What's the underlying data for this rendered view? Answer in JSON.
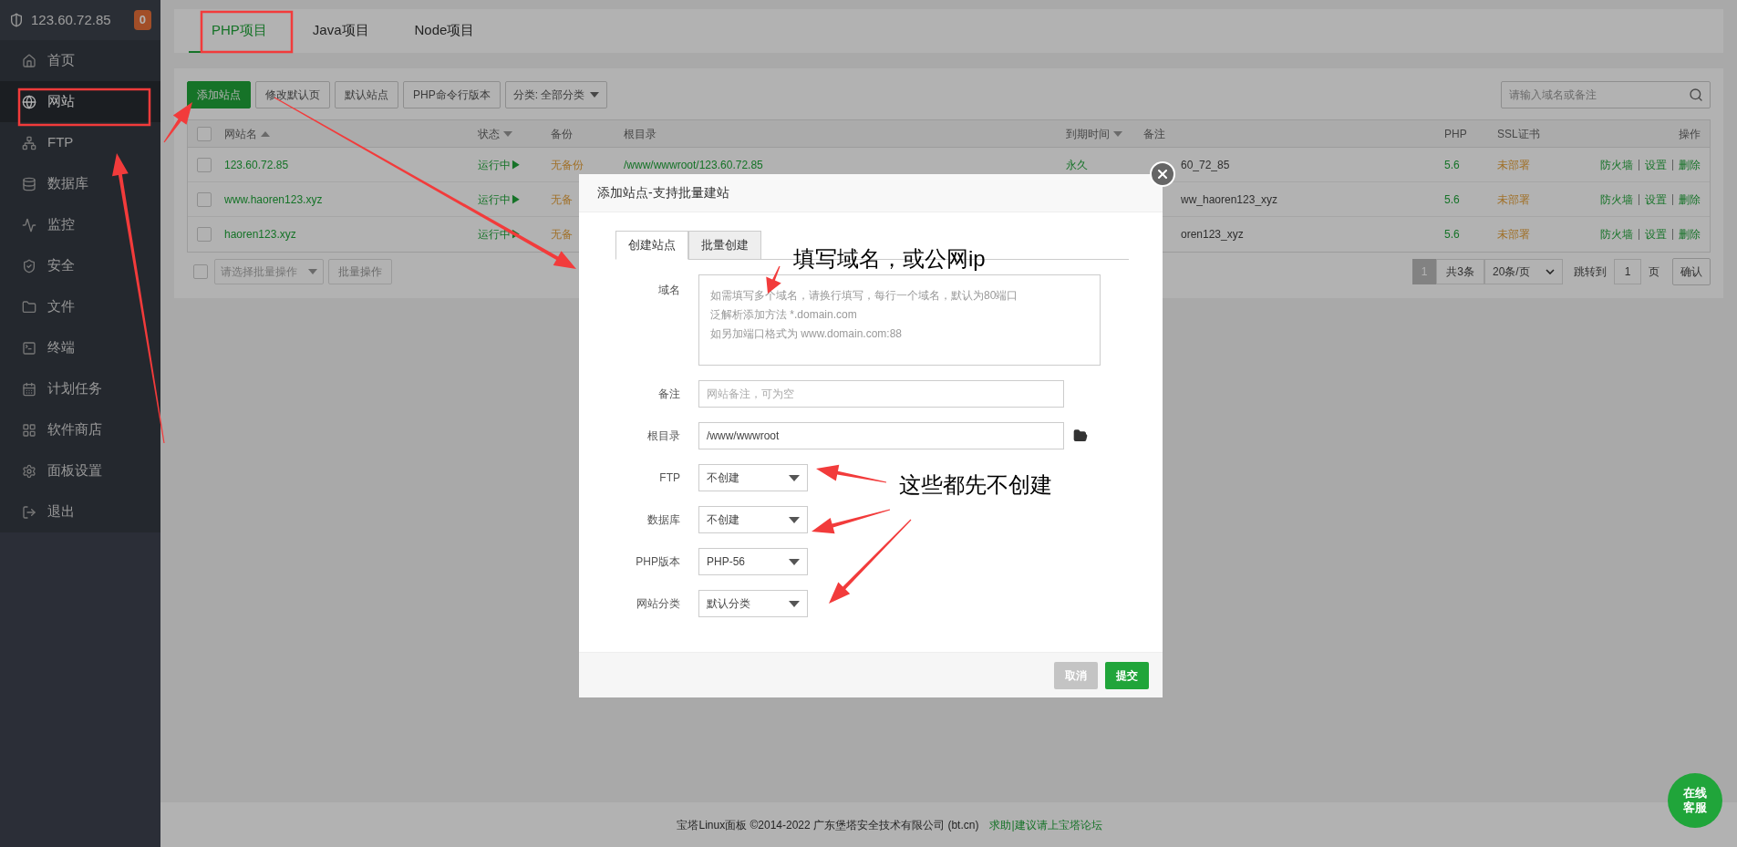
{
  "sidebar": {
    "host": "123.60.72.85",
    "badge": "0",
    "items": [
      {
        "label": "首页",
        "selected": false
      },
      {
        "label": "网站",
        "selected": true
      },
      {
        "label": "FTP",
        "selected": false
      },
      {
        "label": "数据库",
        "selected": false
      },
      {
        "label": "监控",
        "selected": false
      },
      {
        "label": "安全",
        "selected": false
      },
      {
        "label": "文件",
        "selected": false
      },
      {
        "label": "终端",
        "selected": false
      },
      {
        "label": "计划任务",
        "selected": false
      },
      {
        "label": "软件商店",
        "selected": false
      },
      {
        "label": "面板设置",
        "selected": false
      },
      {
        "label": "退出",
        "selected": false
      }
    ]
  },
  "project_tabs": [
    {
      "label": "PHP项目",
      "selected": true
    },
    {
      "label": "Java项目",
      "selected": false
    },
    {
      "label": "Node项目",
      "selected": false
    }
  ],
  "toolbar": {
    "buttons": [
      {
        "label": "添加站点",
        "kind": "primary"
      },
      {
        "label": "修改默认页",
        "kind": "default"
      },
      {
        "label": "默认站点",
        "kind": "default"
      },
      {
        "label": "PHP命令行版本",
        "kind": "default"
      }
    ],
    "category_select": "分类: 全部分类",
    "search": {
      "placeholder": "请输入域名或备注"
    }
  },
  "table": {
    "header_checked": false,
    "columns": [
      {
        "label": "网站名",
        "sort_ascending": true
      },
      {
        "label": "状态",
        "sort_ascending": false
      },
      {
        "label": "备份"
      },
      {
        "label": "根目录"
      },
      {
        "label": "到期时间",
        "sort_ascending": false
      },
      {
        "label": "备注"
      },
      {
        "label": "PHP"
      },
      {
        "label": "SSL证书"
      },
      {
        "label": "操作"
      }
    ],
    "rows": [
      {
        "checked": false,
        "name": "123.60.72.85",
        "status": "运行中▶",
        "backup": "无备份",
        "root_dir": "/www/wwwroot/123.60.72.85",
        "expiry": "永久",
        "remark": "60_72_85",
        "php": "5.6",
        "ssl": "未部署",
        "actions": [
          "防火墙",
          "设置",
          "删除"
        ]
      },
      {
        "checked": false,
        "name": "www.haoren123.xyz",
        "status": "运行中▶",
        "backup": "无备",
        "remark": "ww_haoren123_xyz",
        "php": "5.6",
        "ssl": "未部署",
        "actions": [
          "防火墙",
          "设置",
          "删除"
        ]
      },
      {
        "checked": false,
        "name": "haoren123.xyz",
        "status": "运行中▶",
        "backup": "无备",
        "remark": "oren123_xyz",
        "php": "5.6",
        "ssl": "未部署",
        "actions": [
          "防火墙",
          "设置",
          "删除"
        ]
      }
    ]
  },
  "bulk": {
    "checked": false,
    "select_placeholder": "请选择批量操作",
    "button": "批量操作"
  },
  "pagination": {
    "pages": [
      {
        "label": "1",
        "selected": true
      }
    ],
    "total": "共3条",
    "page_size": "20条/页",
    "jump_label": "跳转到",
    "jump_value": "1",
    "page_unit": "页",
    "confirm": "确认"
  },
  "footer": {
    "copyright": "宝塔Linux面板 ©2014-2022 广东堡塔安全技术有限公司 (bt.cn)",
    "link": "求助|建议请上宝塔论坛"
  },
  "chat_button": "在线客服",
  "modal": {
    "title": "添加站点-支持批量建站",
    "tabs": [
      {
        "label": "创建站点",
        "selected": true
      },
      {
        "label": "批量创建",
        "selected": false
      }
    ],
    "fields": [
      {
        "kind": "textarea",
        "label": "域名",
        "placeholder": [
          "如需填写多个域名，请换行填写，每行一个域名，默认为80端口",
          "泛解析添加方法 *.domain.com",
          "如另加端口格式为 www.domain.com:88"
        ]
      },
      {
        "kind": "input",
        "label": "备注",
        "placeholder": "网站备注，可为空"
      },
      {
        "kind": "path",
        "label": "根目录",
        "value": "/www/wwwroot"
      },
      {
        "kind": "select",
        "label": "FTP",
        "value": "不创建"
      },
      {
        "kind": "select",
        "label": "数据库",
        "value": "不创建"
      },
      {
        "kind": "select",
        "label": "PHP版本",
        "value": "PHP-56"
      },
      {
        "kind": "select",
        "label": "网站分类",
        "value": "默认分类"
      }
    ],
    "buttons": [
      {
        "label": "取消",
        "kind": "cancel"
      },
      {
        "label": "提交",
        "kind": "primary"
      }
    ]
  },
  "annotations": [
    {
      "text": "填写域名，或公网ip"
    },
    {
      "text": "这些都先不创建"
    }
  ]
}
